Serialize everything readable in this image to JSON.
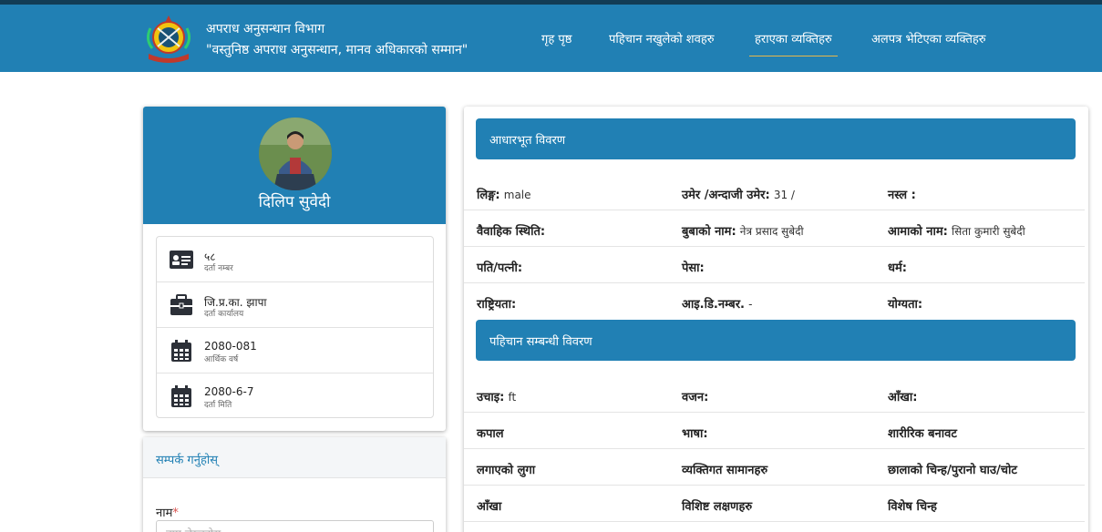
{
  "header": {
    "title": "अपराध अनुसन्धान विभाग",
    "subtitle": "\"वस्तुनिष्ठ अपराध अनुसन्धान, मानव अधिकारको सम्मान\"",
    "nav": [
      {
        "label": "गृह पृष्ठ",
        "active": false
      },
      {
        "label": "पहिचान नखुलेको शवहरु",
        "active": false
      },
      {
        "label": "हराएका व्यक्तिहरु",
        "active": true
      },
      {
        "label": "अलपत्र भेटिएका व्यक्तिहरु",
        "active": false
      }
    ],
    "colors": {
      "primary": "#2180b4",
      "dark": "#123c55",
      "accent": "#e8b84a"
    }
  },
  "profile": {
    "name": "दिलिप सुवेदी",
    "info": [
      {
        "icon": "id-card-icon",
        "value": "५८",
        "label": "दर्ता नम्बर"
      },
      {
        "icon": "briefcase-icon",
        "value": "जि.प्र.का. झापा",
        "label": "दर्ता कार्यालय"
      },
      {
        "icon": "calendar-icon",
        "value": "2080-081",
        "label": "आर्थिक वर्ष"
      },
      {
        "icon": "calendar-icon",
        "value": "2080-6-7",
        "label": "दर्ता मिति"
      }
    ]
  },
  "contact": {
    "title": "सम्पर्क गर्नुहोस्",
    "name_label": "नाम",
    "required_mark": "*",
    "name_placeholder": "नाम लेख्नुहोस्"
  },
  "basic": {
    "title": "आधारभूत विवरण",
    "rows": [
      [
        {
          "label": "लिङ्ग:",
          "value": "male"
        },
        {
          "label": "उमेर /अन्दाजी उमेर:",
          "value": "31 /"
        },
        {
          "label": "नस्ल :",
          "value": ""
        }
      ],
      [
        {
          "label": "वैवाहिक स्थिति:",
          "value": ""
        },
        {
          "label": "बुबाको नाम:",
          "value": "नेत्र प्रसाद सुबेदी"
        },
        {
          "label": "आमाको नाम:",
          "value": "सिता कुमारी सुबेदी"
        }
      ],
      [
        {
          "label": "पति/पत्नी:",
          "value": ""
        },
        {
          "label": "पेसा:",
          "value": ""
        },
        {
          "label": "धर्म:",
          "value": ""
        }
      ],
      [
        {
          "label": "राष्ट्रियता:",
          "value": ""
        },
        {
          "label": "आइ.डि.नम्बर.",
          "value": "-"
        },
        {
          "label": "योग्यता:",
          "value": ""
        }
      ]
    ]
  },
  "identity": {
    "title": "पहिचान सम्बन्धी विवरण",
    "rows": [
      [
        {
          "label": "उचाइ:",
          "value": "ft"
        },
        {
          "label": "वजन:",
          "value": ""
        },
        {
          "label": "आँखा:",
          "value": ""
        }
      ],
      [
        {
          "label": "कपाल",
          "value": ""
        },
        {
          "label": "भाषा:",
          "value": ""
        },
        {
          "label": "शारीरिक बनावट",
          "value": ""
        }
      ],
      [
        {
          "label": "लगाएको लुगा",
          "value": ""
        },
        {
          "label": "व्यक्तिगत सामानहरु",
          "value": ""
        },
        {
          "label": "छालाको चिन्ह/पुरानो घाउ/चोट",
          "value": ""
        }
      ],
      [
        {
          "label": "आँखा",
          "value": ""
        },
        {
          "label": "विशिष्ट लक्षणहरु",
          "value": ""
        },
        {
          "label": "विशेष चिन्ह",
          "value": ""
        }
      ]
    ]
  }
}
